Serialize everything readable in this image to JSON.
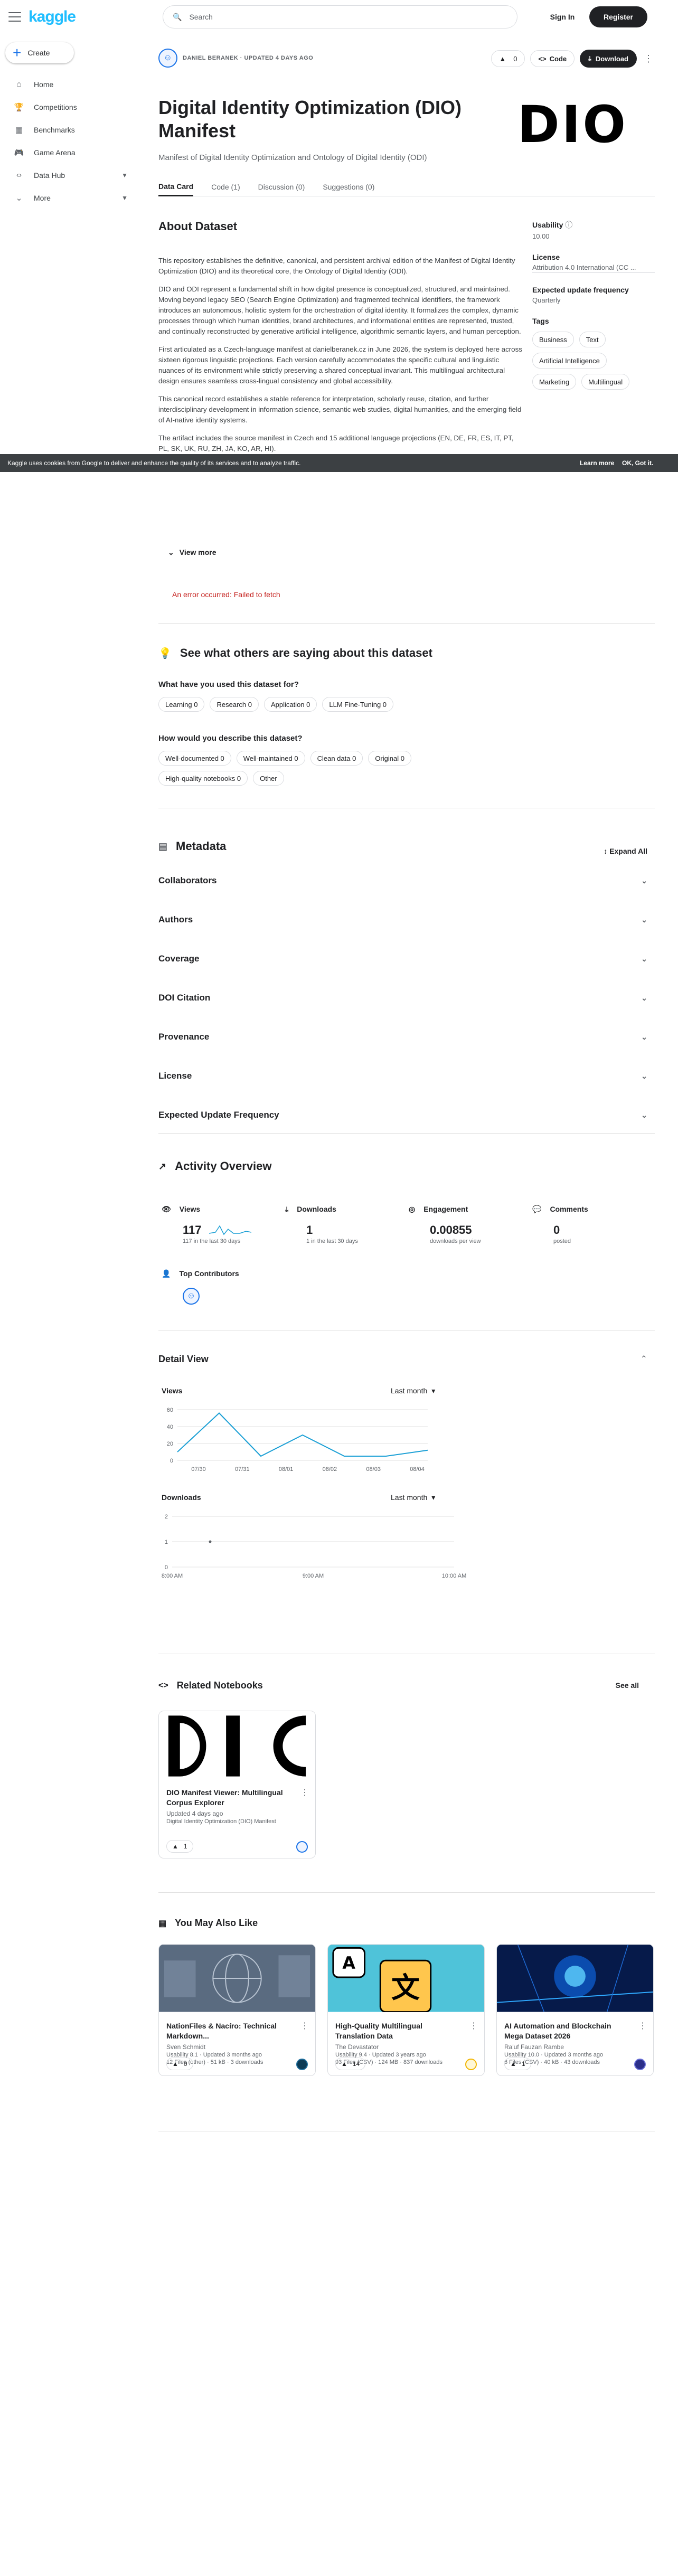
{
  "app": {
    "logo": "kaggle",
    "create_label": "Create"
  },
  "nav": [
    {
      "icon": "⌂",
      "label": "Home",
      "chev": ""
    },
    {
      "icon": "🏆",
      "label": "Competitions",
      "chev": ""
    },
    {
      "icon": "▦",
      "label": "Benchmarks",
      "chev": ""
    },
    {
      "icon": "🎮",
      "label": "Game Arena",
      "chev": ""
    },
    {
      "icon": "‹›",
      "label": "Data Hub",
      "chev": "▼"
    },
    {
      "icon": "⌄",
      "label": "More",
      "chev": "▼"
    }
  ],
  "top": {
    "search_placeholder": "Search",
    "signin": "Sign In",
    "register": "Register"
  },
  "dataset": {
    "owner_line": "DANIEL BERANEK · UPDATED 4 DAYS AGO",
    "votes": "0",
    "code_label": "Code",
    "download_label": "Download",
    "title": "Digital Identity Optimization (DIO) Manifest",
    "logo_text": "DIO",
    "subtitle": "Manifest of Digital Identity Optimization and Ontology of Digital Identity (ODI)",
    "tabs": [
      "Data Card",
      "Code (1)",
      "Discussion (0)",
      "Suggestions (0)"
    ],
    "about_heading": "About Dataset",
    "about": [
      "This repository establishes the definitive, canonical, and persistent archival edition of the Manifest of Digital Identity Optimization (DIO) and its theoretical core, the Ontology of Digital Identity (ODI).",
      "DIO and ODI represent a fundamental shift in how digital presence is conceptualized, structured, and maintained. Moving beyond legacy SEO (Search Engine Optimization) and fragmented technical identifiers, the framework introduces an autonomous, holistic system for the orchestration of digital identity. It formalizes the complex, dynamic processes through which human identities, brand architectures, and informational entities are represented, trusted, and continually reconstructed by generative artificial intelligence, algorithmic semantic layers, and human perception.",
      "First articulated as a Czech-language manifest at danielberanek.cz in June 2026, the system is deployed here across sixteen rigorous linguistic projections. Each version carefully accommodates the specific cultural and linguistic nuances of its environment while strictly preserving a shared conceptual invariant. This multilingual architectural design ensures seamless cross-lingual consistency and global accessibility.",
      "This canonical record establishes a stable reference for interpretation, scholarly reuse, citation, and further interdisciplinary development in information science, semantic web studies, digital humanities, and the emerging field of AI-native identity systems.",
      "The artifact includes the source manifest in Czech and 15 additional language projections (EN, DE, FR, ES, IT, PT, PL, SK, UK, RU, ZH, JA, KO, AR, HI)."
    ],
    "usability_label": "Usability",
    "usability": "10.00",
    "license_label": "License",
    "license": "Attribution 4.0 International (CC ...",
    "update_label": "Expected update frequency",
    "update": "Quarterly",
    "tags_label": "Tags",
    "tags": [
      "Business",
      "Text",
      "Artificial Intelligence",
      "Marketing",
      "Multilingual"
    ]
  },
  "cookie": {
    "text": "Kaggle uses cookies from Google to deliver and enhance the quality of its services and to analyze traffic.",
    "learn": "Learn more",
    "ok": "OK, Got it."
  },
  "view_more": "View more",
  "error": "An error occurred: Failed to fetch",
  "others": {
    "heading": "See what others are saying about this dataset",
    "q1": "What have you used this dataset for?",
    "uses": [
      "Learning 0",
      "Research 0",
      "Application 0",
      "LLM Fine-Tuning 0"
    ],
    "q2": "How would you describe this dataset?",
    "desc": [
      "Well-documented 0",
      "Well-maintained 0",
      "Clean data 0",
      "Original 0",
      "High-quality notebooks 0",
      "Other"
    ]
  },
  "metadata": {
    "heading": "Metadata",
    "expand": "Expand All",
    "rows": [
      "Collaborators",
      "Authors",
      "Coverage",
      "DOI Citation",
      "Provenance",
      "License",
      "Expected Update Frequency"
    ]
  },
  "activity": {
    "heading": "Activity Overview",
    "views_label": "Views",
    "views": "117",
    "views_sub": "117 in the last 30 days",
    "downloads_label": "Downloads",
    "downloads": "1",
    "downloads_sub": "1 in the last 30 days",
    "engagement_label": "Engagement",
    "engagement": "0.00855",
    "engagement_sub": "downloads per view",
    "comments_label": "Comments",
    "comments": "0",
    "comments_sub": "posted",
    "contrib_label": "Top Contributors"
  },
  "detail": {
    "heading": "Detail View",
    "views_title": "Views",
    "period": "Last month",
    "downloads_title": "Downloads"
  },
  "chart_data": [
    {
      "type": "line",
      "title": "Views",
      "categories": [
        "07/30",
        "07/31",
        "08/01",
        "08/02",
        "08/03",
        "08/04"
      ],
      "x": [
        0,
        0.5,
        1,
        1.5,
        2,
        2.5,
        3,
        3.5,
        4,
        4.5,
        5
      ],
      "values": [
        10,
        56,
        5,
        30,
        5,
        5,
        12
      ],
      "yticks": [
        "0",
        "20",
        "40",
        "60"
      ],
      "ylim": [
        0,
        60
      ]
    },
    {
      "type": "line",
      "title": "Downloads",
      "categories": [
        "8:00 AM",
        "9:00 AM",
        "10:00 AM"
      ],
      "values": [
        1
      ],
      "yticks": [
        "0",
        "1",
        "2"
      ],
      "ylim": [
        0,
        2
      ]
    }
  ],
  "notebooks": {
    "heading": "Related Notebooks",
    "see_all": "See all",
    "card": {
      "title": "DIO Manifest Viewer: Multilingual Corpus Explorer",
      "updated": "Updated 4 days ago",
      "source": "Digital Identity Optimization (DIO) Manifest",
      "votes": "1"
    }
  },
  "also": {
    "heading": "You May Also Like",
    "cards": [
      {
        "title": "NationFiles & Nacíro: Technical Markdown...",
        "owner": "Sven Schmidt",
        "meta1": "Usability 8.1 · Updated 3 months ago",
        "meta2": "12 Files (other) · 51 kB · 3 downloads",
        "votes": "0"
      },
      {
        "title": "High-Quality Multilingual Translation Data",
        "owner": "The Devastator",
        "meta1": "Usability 9.4 · Updated 3 years ago",
        "meta2": "93 Files (CSV) · 124 MB · 837 downloads",
        "votes": "14"
      },
      {
        "title": "AI Automation and Blockchain Mega Dataset 2026",
        "owner": "Ra'uf Fauzan Rambe",
        "meta1": "Usability 10.0 · Updated 3 months ago",
        "meta2": "6 Files (CSV) · 40 kB · 43 downloads",
        "votes": "1"
      }
    ]
  }
}
